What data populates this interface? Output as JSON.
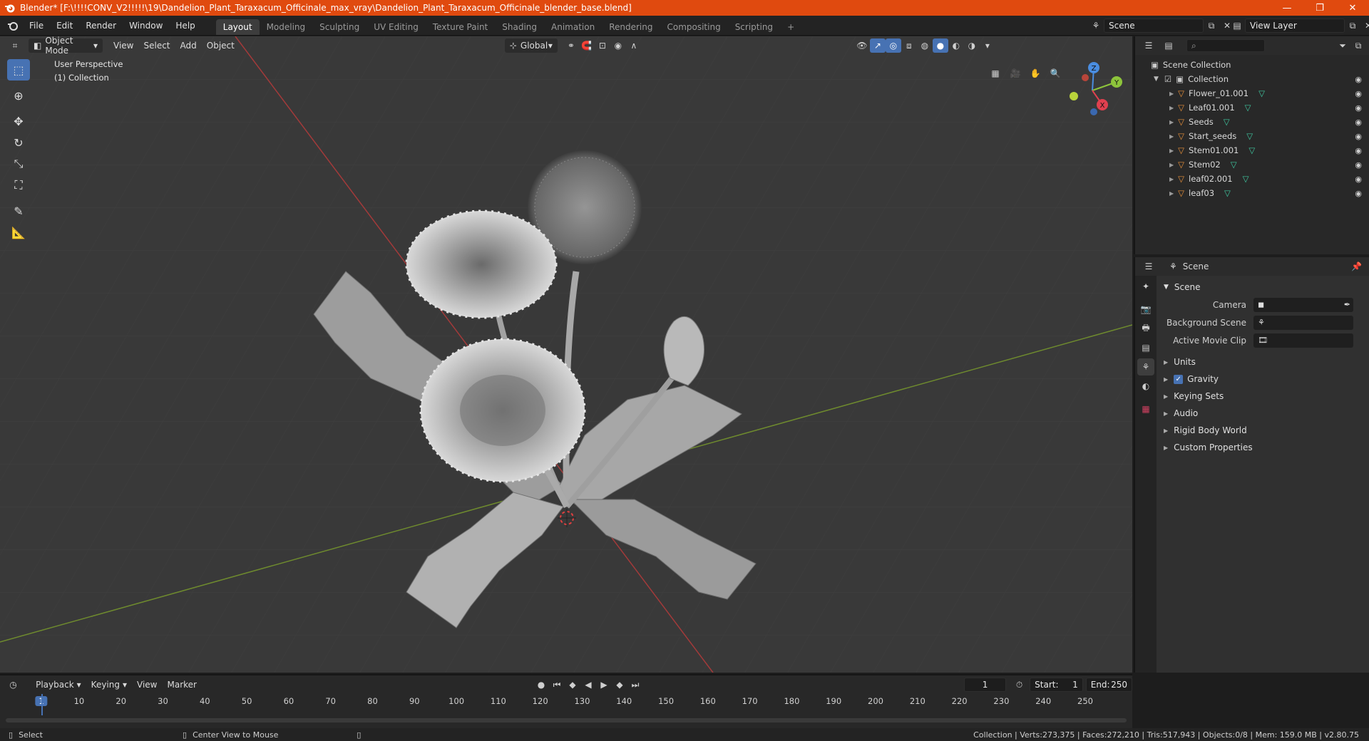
{
  "titlebar": {
    "title": "Blender* [F:\\!!!!CONV_V2!!!!!\\19\\Dandelion_Plant_Taraxacum_Officinale_max_vray\\Dandelion_Plant_Taraxacum_Officinale_blender_base.blend]",
    "minimize": "—",
    "restore": "❐",
    "close": "✕"
  },
  "menu": [
    "File",
    "Edit",
    "Render",
    "Window",
    "Help"
  ],
  "workspaces": [
    "Layout",
    "Modeling",
    "Sculpting",
    "UV Editing",
    "Texture Paint",
    "Shading",
    "Animation",
    "Rendering",
    "Compositing",
    "Scripting"
  ],
  "workspace_add": "+",
  "scene_field": "Scene",
  "view_layer_field": "View Layer",
  "viewport": {
    "mode": "Object Mode",
    "menus": [
      "View",
      "Select",
      "Add",
      "Object"
    ],
    "transform_orientation": "Global",
    "overlay_title": "User Perspective",
    "overlay_subtitle": "(1) Collection",
    "gizmo": {
      "z": "Z",
      "y": "Y",
      "x": "X"
    }
  },
  "outliner": {
    "search_placeholder": "",
    "root": "Scene Collection",
    "collection": "Collection",
    "objects": [
      "Flower_01.001",
      "Leaf01.001",
      "Seeds",
      "Start_seeds",
      "Stem01.001",
      "Stem02",
      "leaf02.001",
      "leaf03"
    ]
  },
  "properties": {
    "header": "Scene",
    "panel_title": "Scene",
    "fields": [
      {
        "label": "Camera",
        "value": ""
      },
      {
        "label": "Background Scene",
        "value": ""
      },
      {
        "label": "Active Movie Clip",
        "value": ""
      }
    ],
    "sections": [
      "Units",
      "Gravity",
      "Keying Sets",
      "Audio",
      "Rigid Body World",
      "Custom Properties"
    ],
    "gravity_checked": true
  },
  "timeline": {
    "menus": [
      "Playback",
      "Keying",
      "View",
      "Marker"
    ],
    "current_frame": "1",
    "start_label": "Start:",
    "start_value": "1",
    "end_label": "End:",
    "end_value": "250",
    "ruler": [
      "1",
      "10",
      "20",
      "30",
      "40",
      "50",
      "60",
      "70",
      "80",
      "90",
      "100",
      "110",
      "120",
      "130",
      "140",
      "150",
      "160",
      "170",
      "180",
      "190",
      "200",
      "210",
      "220",
      "230",
      "240",
      "250"
    ]
  },
  "status": {
    "left_action": "Select",
    "middle_action": "Center View to Mouse",
    "right_info": "Collection | Verts:273,375 | Faces:272,210 | Tris:517,943 | Objects:0/8 | Mem: 159.0 MB | v2.80.75"
  },
  "colors": {
    "accent": "#4772b3",
    "titlebar": "#e04a0f",
    "object_icon": "#e8903a",
    "mesh_data_icon": "#3fc7a0",
    "x_axis": "#e0404f",
    "y_axis": "#8dc43b",
    "z_axis": "#4a8de0"
  }
}
